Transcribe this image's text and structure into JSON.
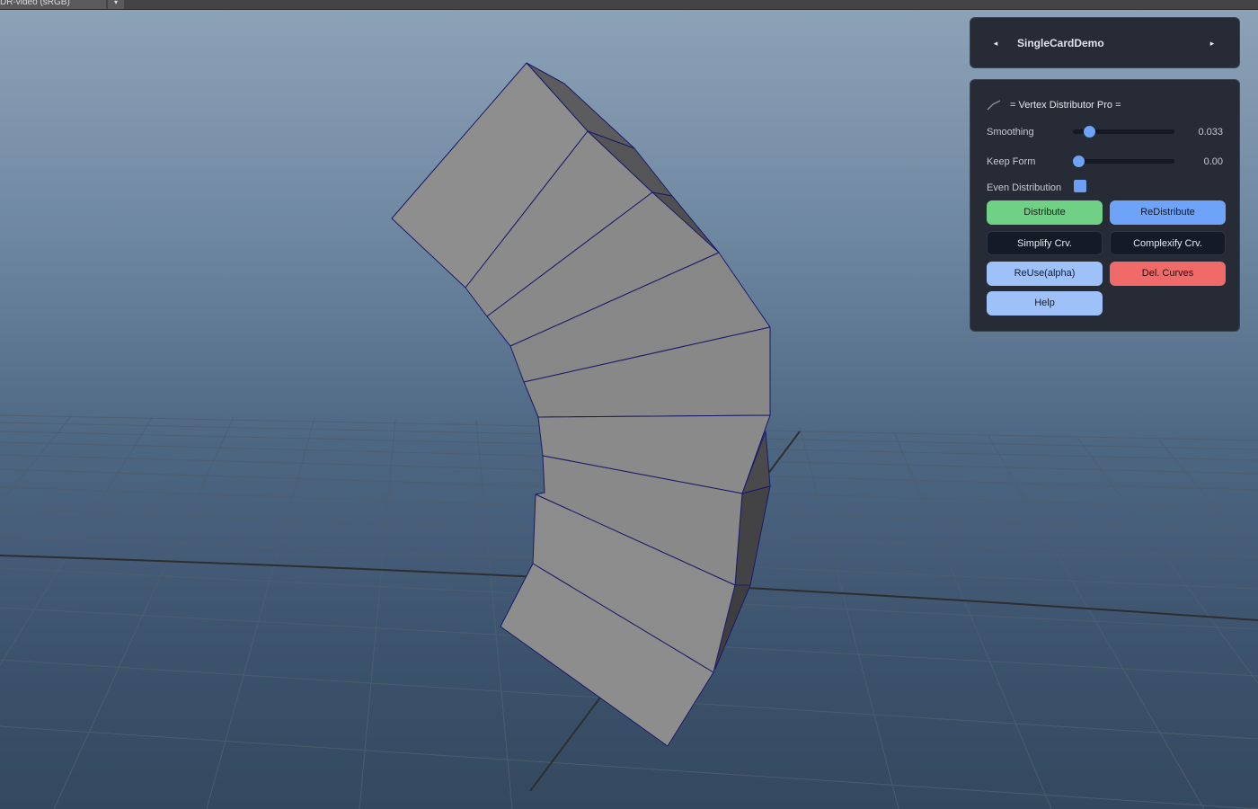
{
  "viewport": {
    "colorspace_label": "DR-video (sRGB)",
    "colorspace_arrow": "▾"
  },
  "header": {
    "prev_icon": "◂",
    "title": "SingleCardDemo",
    "next_icon": "▸"
  },
  "tool": {
    "title": "= Vertex Distributor Pro =",
    "icon": "curve-icon",
    "smoothing": {
      "label": "Smoothing",
      "value": "0.033",
      "level": 0.12
    },
    "keep_form": {
      "label": "Keep Form",
      "value": "0.00",
      "level": 0.0
    },
    "even_distribution": {
      "label": "Even Distribution",
      "checked": true
    },
    "buttons": {
      "distribute": "Distribute",
      "redistribute": "ReDistribute",
      "simplify": "Simplify Crv.",
      "complexify": "Complexify Crv.",
      "reuse": "ReUse(alpha)",
      "delete_curves": "Del. Curves",
      "help": "Help"
    }
  },
  "colors": {
    "accent_blue": "#6fa3f7",
    "accent_green": "#6fd086",
    "accent_red": "#f06a6a",
    "panel_bg": "#262b35",
    "mesh_face": "#8c8c8c",
    "mesh_wire": "#1a1a6a"
  }
}
